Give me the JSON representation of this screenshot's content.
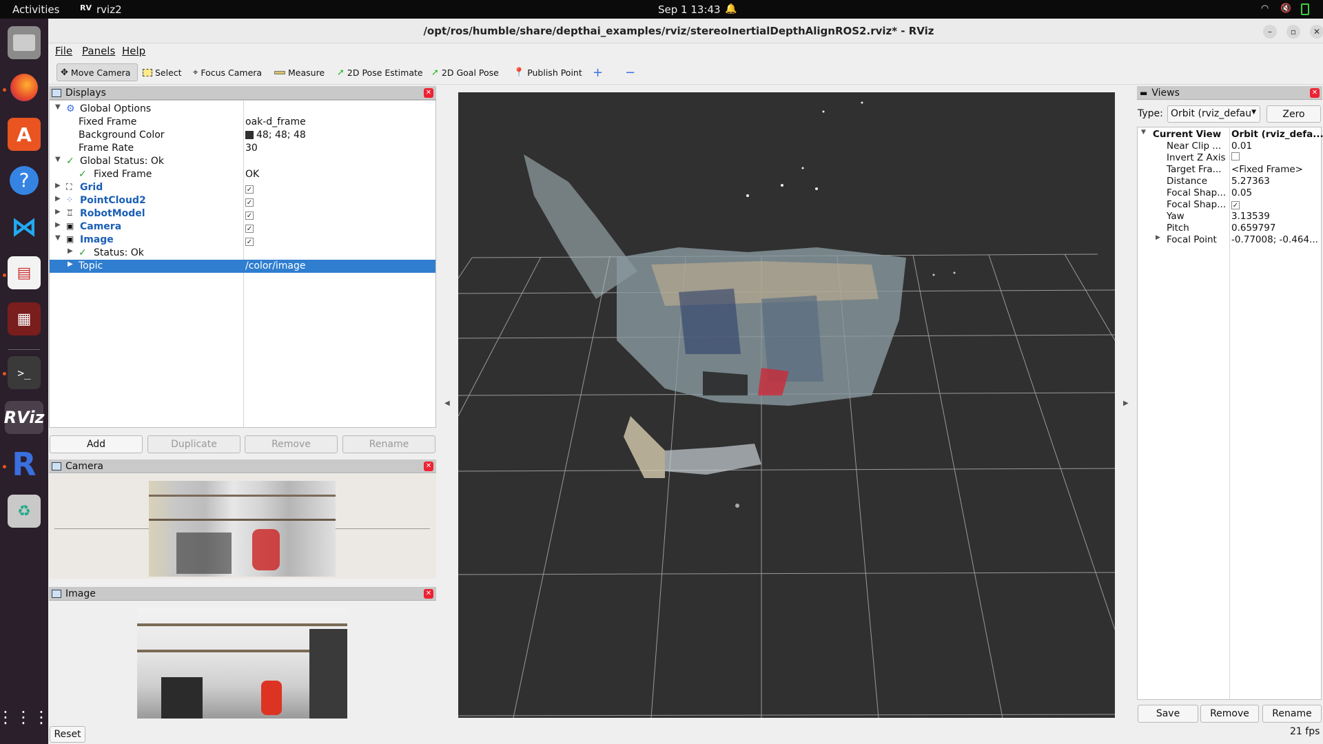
{
  "topbar": {
    "activities": "Activities",
    "app_name": "rviz2",
    "datetime": "Sep 1  13:43"
  },
  "window": {
    "title": "/opt/ros/humble/share/depthai_examples/rviz/stereoInertialDepthAlignROS2.rviz* - RViz"
  },
  "menu": {
    "file": "File",
    "panels": "Panels",
    "help": "Help"
  },
  "toolbar": {
    "move_camera": "Move Camera",
    "select": "Select",
    "focus_camera": "Focus Camera",
    "measure": "Measure",
    "pose_estimate": "2D Pose Estimate",
    "goal_pose": "2D Goal Pose",
    "publish_point": "Publish Point",
    "plus": "+",
    "minus": "−"
  },
  "displays": {
    "title": "Displays",
    "global_options": "Global Options",
    "fixed_frame_label": "Fixed Frame",
    "fixed_frame_value": "oak-d_frame",
    "bg_color_label": "Background Color",
    "bg_color_value": "48; 48; 48",
    "bg_color_swatch": "#303030",
    "frame_rate_label": "Frame Rate",
    "frame_rate_value": "30",
    "global_status": "Global Status: Ok",
    "status_fixed_frame": "Fixed Frame",
    "status_fixed_frame_value": "OK",
    "grid": "Grid",
    "pointcloud": "PointCloud2",
    "robotmodel": "RobotModel",
    "camera": "Camera",
    "image": "Image",
    "image_status": "Status: Ok",
    "topic_label": "Topic",
    "topic_value": "/color/image",
    "add": "Add",
    "duplicate": "Duplicate",
    "remove": "Remove",
    "rename": "Rename"
  },
  "camera_panel": {
    "title": "Camera"
  },
  "image_panel": {
    "title": "Image"
  },
  "reset": "Reset",
  "views": {
    "title": "Views",
    "type_label": "Type:",
    "type_value": "Orbit (rviz_defau",
    "zero": "Zero",
    "current_view": "Current View",
    "current_view_value": "Orbit (rviz_defa...",
    "rows": [
      {
        "k": "Near Clip ...",
        "v": "0.01"
      },
      {
        "k": "Invert Z Axis",
        "v": ""
      },
      {
        "k": "Target Fra...",
        "v": "<Fixed Frame>"
      },
      {
        "k": "Distance",
        "v": "5.27363"
      },
      {
        "k": "Focal Shap...",
        "v": "0.05"
      },
      {
        "k": "Focal Shap...",
        "v": ""
      },
      {
        "k": "Yaw",
        "v": "3.13539"
      },
      {
        "k": "Pitch",
        "v": "0.659797"
      },
      {
        "k": "Focal Point",
        "v": "-0.77008; -0.464..."
      }
    ],
    "save": "Save",
    "remove": "Remove",
    "rename": "Rename"
  },
  "fps": "21 fps",
  "colors": {
    "accent": "#2f7ed0",
    "viewport_bg": "#303030",
    "dock_bg": "#2a1f2b"
  }
}
